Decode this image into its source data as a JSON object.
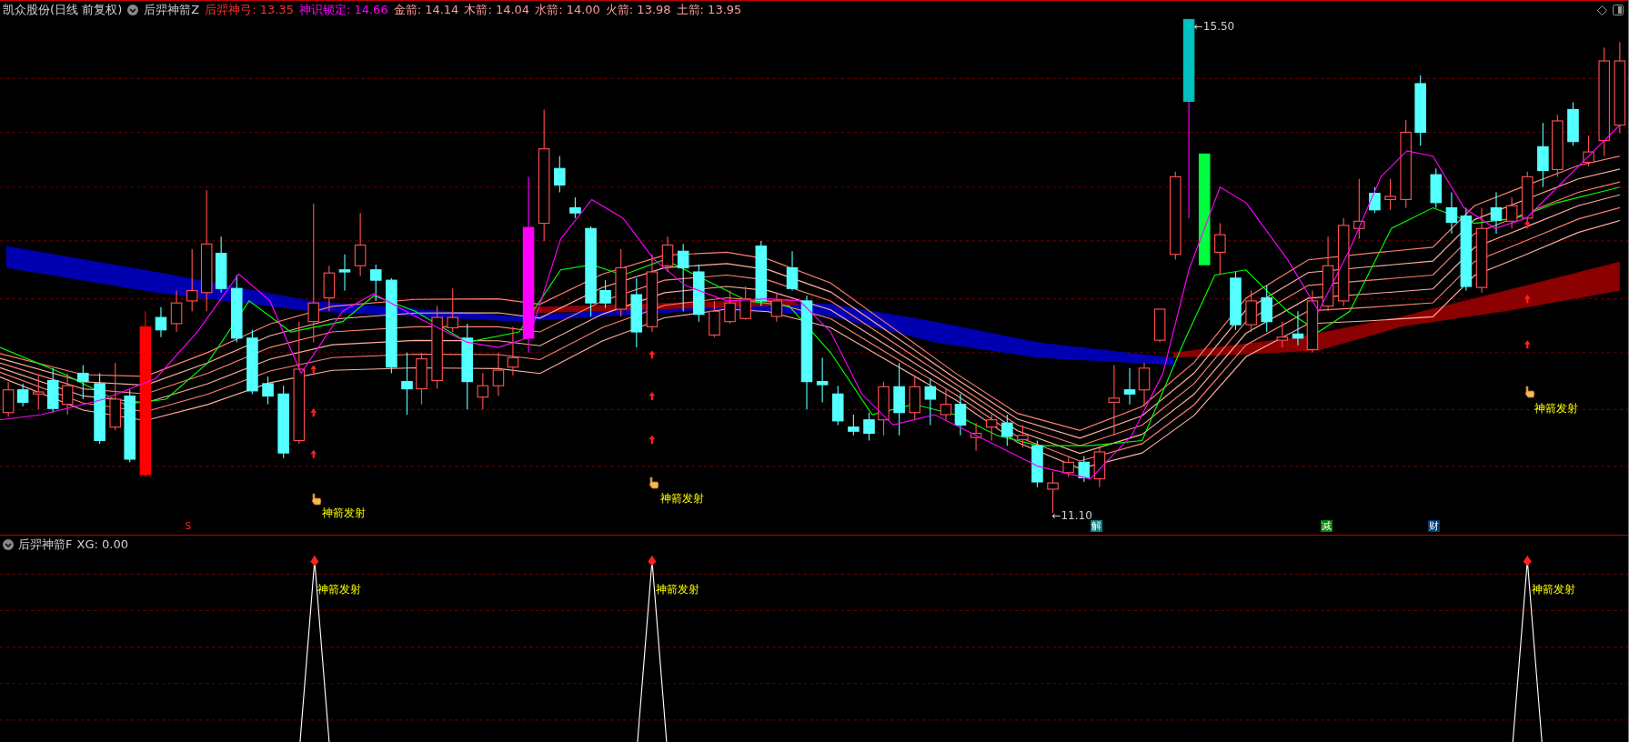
{
  "main_panel": {
    "stock_title": "凯众股份(日线 前复权)",
    "indicator_name": "后羿神箭Z",
    "readings": [
      {
        "label": "后羿神弓: 13.35",
        "color": "#ff3030"
      },
      {
        "label": "神识锁定: 14.66",
        "color": "#ff00ff"
      },
      {
        "label": "金箭: 14.14",
        "color": "#ff9c9c"
      },
      {
        "label": "木箭: 14.04",
        "color": "#ff9c9c"
      },
      {
        "label": "水箭: 14.00",
        "color": "#ff9c9c"
      },
      {
        "label": "火箭: 13.98",
        "color": "#ff9c9c"
      },
      {
        "label": "土箭: 13.95",
        "color": "#ff9c9c"
      }
    ],
    "price_labels": [
      "←15.50",
      "←11.10"
    ],
    "signals": [
      "神箭发射",
      "神箭发射",
      "神箭发射"
    ],
    "markers": [
      {
        "text": "S",
        "kind": "letter",
        "color": "#ff2020"
      },
      {
        "text": "解",
        "kind": "tag",
        "color": "#008080"
      },
      {
        "text": "减",
        "kind": "tag",
        "color": "#008000"
      },
      {
        "text": "财",
        "kind": "tag",
        "color": "#003a70"
      }
    ]
  },
  "sub_panel": {
    "indicator_name": "后羿神箭F",
    "reading": "XG: 0.00",
    "signals": [
      "神箭发射",
      "神箭发射",
      "神箭发射"
    ]
  }
}
